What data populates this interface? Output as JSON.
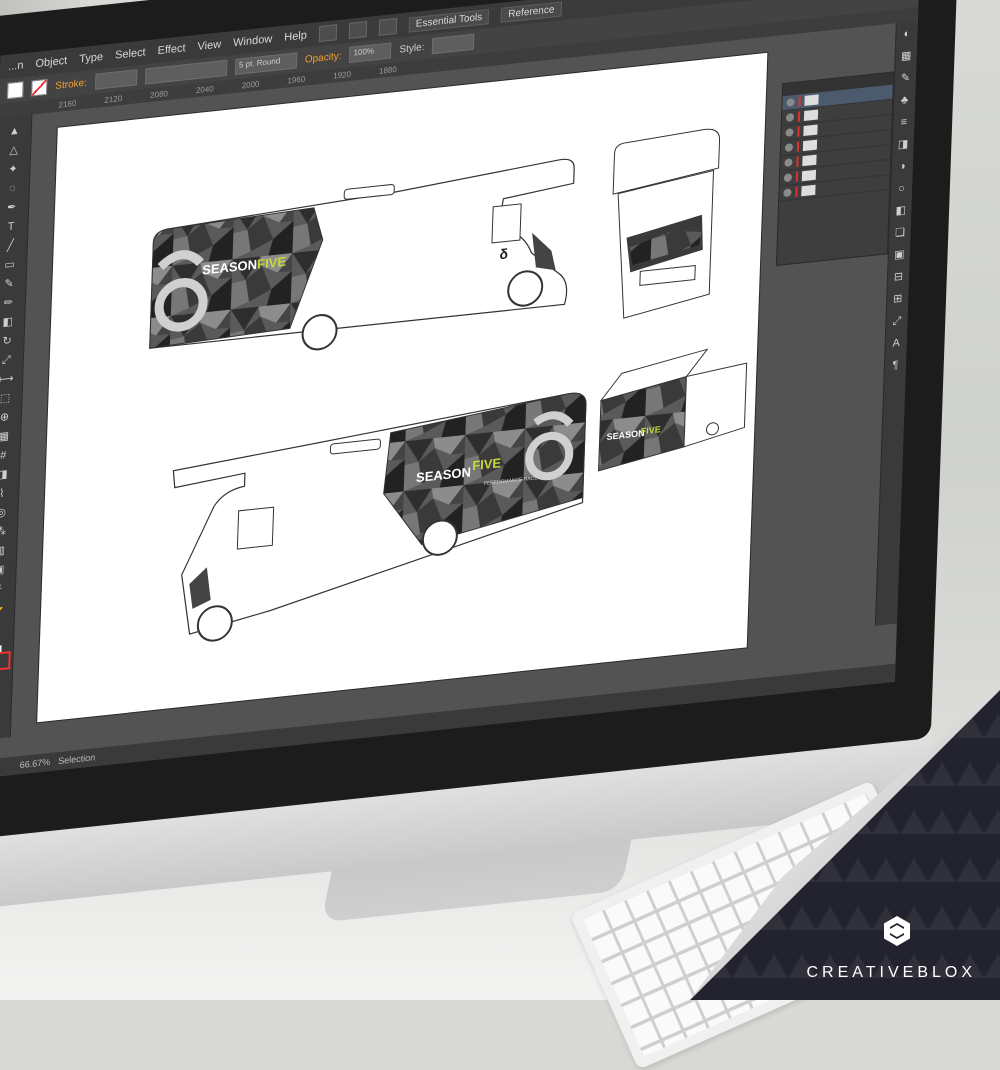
{
  "app": {
    "menu": [
      "...n",
      "Object",
      "Type",
      "Select",
      "Effect",
      "View",
      "Window",
      "Help"
    ],
    "workspace_label": "Essential Tools",
    "search_label": "Reference"
  },
  "control_bar": {
    "stroke_label": "Stroke:",
    "brush_label": "5 pt. Round",
    "opacity_label": "Opacity:",
    "opacity_value": "100%",
    "style_label": "Style:"
  },
  "ruler_ticks": [
    "2160",
    "2120",
    "2080",
    "2040",
    "2000",
    "1960",
    "1920",
    "1880"
  ],
  "status": {
    "zoom": "66.67%",
    "tool": "Selection"
  },
  "artwork": {
    "brand_word_1": "SEASON",
    "brand_word_2": "FIVE",
    "tagline": "PERFORMANCE RACE",
    "accent_color": "#c8d83a",
    "camo_dark": "#2e2e2e",
    "camo_mid": "#5a5a5a",
    "camo_light": "#8c8c8c"
  },
  "brand": {
    "name": "CREATIVEBLOX",
    "logo_icon": "hexagon-c-icon"
  },
  "tools": [
    "selection-icon",
    "direct-select-icon",
    "magic-wand-icon",
    "lasso-icon",
    "pen-icon",
    "type-icon",
    "line-icon",
    "rectangle-icon",
    "paintbrush-icon",
    "pencil-icon",
    "eraser-icon",
    "rotate-icon",
    "scale-icon",
    "width-icon",
    "free-transform-icon",
    "shape-builder-icon",
    "perspective-icon",
    "mesh-icon",
    "gradient-icon",
    "eyedropper-icon",
    "blend-icon",
    "symbol-sprayer-icon",
    "graph-icon",
    "artboard-icon",
    "slice-icon",
    "hand-icon",
    "zoom-icon"
  ]
}
